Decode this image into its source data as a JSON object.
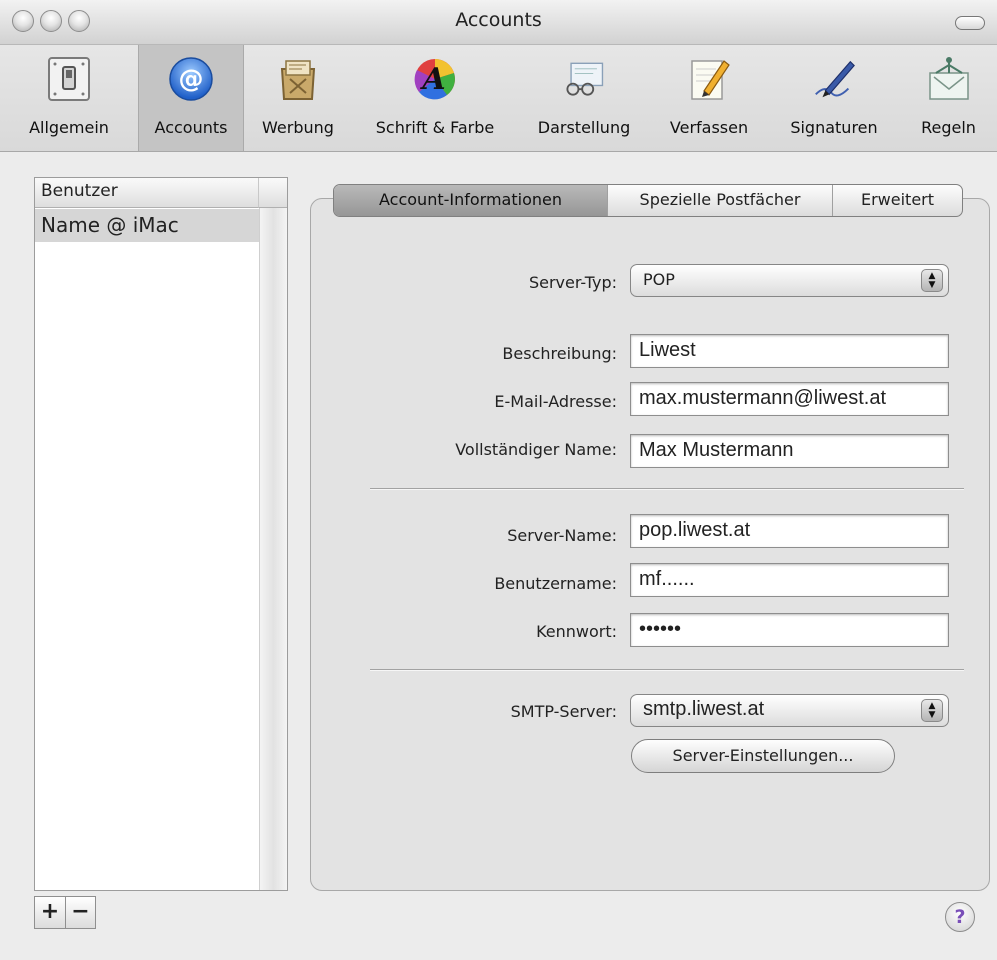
{
  "window": {
    "title": "Accounts"
  },
  "toolbar": {
    "items": [
      {
        "label": "Allgemein",
        "icon": "general-switch-icon"
      },
      {
        "label": "Accounts",
        "icon": "at-sign-icon"
      },
      {
        "label": "Werbung",
        "icon": "junk-mail-icon"
      },
      {
        "label": "Schrift & Farbe",
        "icon": "font-color-icon"
      },
      {
        "label": "Darstellung",
        "icon": "viewing-glasses-icon"
      },
      {
        "label": "Verfassen",
        "icon": "compose-pencil-icon"
      },
      {
        "label": "Signaturen",
        "icon": "signature-pen-icon"
      },
      {
        "label": "Regeln",
        "icon": "rules-icon"
      }
    ],
    "selected": "Accounts"
  },
  "accounts_list": {
    "header": "Benutzer",
    "items": [
      "Name @ iMac"
    ],
    "add_label": "+",
    "remove_label": "−"
  },
  "tabs": [
    "Account-Informationen",
    "Spezielle Postfächer",
    "Erweitert"
  ],
  "form": {
    "server_type": {
      "label": "Server-Typ:",
      "value": "POP"
    },
    "description": {
      "label": "Beschreibung:",
      "value": "Liwest"
    },
    "email": {
      "label": "E-Mail-Adresse:",
      "value": "max.mustermann@liwest.at"
    },
    "full_name": {
      "label": "Vollständiger Name:",
      "value": "Max Mustermann"
    },
    "server_name": {
      "label": "Server-Name:",
      "value": "pop.liwest.at"
    },
    "username": {
      "label": "Benutzername:",
      "value": "mf......"
    },
    "password": {
      "label": "Kennwort:",
      "value": "••••••"
    },
    "smtp": {
      "label": "SMTP-Server:",
      "value": "smtp.liwest.at"
    },
    "server_settings_button": "Server-Einstellungen..."
  },
  "help": {
    "label": "?"
  },
  "colors": {
    "selected_tab": "#a9a9a9",
    "help_icon": "#7a4fb8"
  }
}
